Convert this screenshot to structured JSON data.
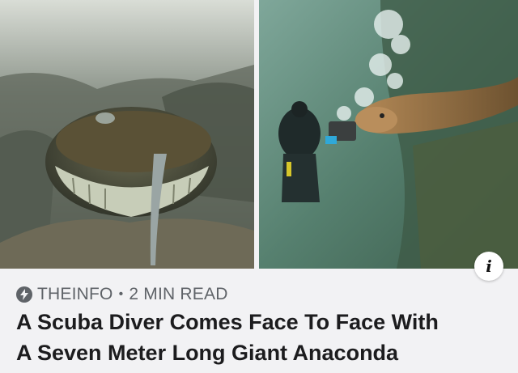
{
  "article": {
    "source": "THEINFO",
    "separator": "•",
    "read_time": "2 MIN READ",
    "headline_line1": "A Scuba Diver Comes Face To Face With",
    "headline_line2": "A Seven Meter Long Giant Anaconda"
  },
  "info_button": {
    "label": "i"
  },
  "icons": {
    "source": "lightning-bolt-icon",
    "info": "info-icon"
  },
  "colors": {
    "water_left": "#6f7a6c",
    "water_right": "#5c8a7a",
    "text_primary": "#1c1c1e",
    "text_secondary": "#5f6368"
  }
}
